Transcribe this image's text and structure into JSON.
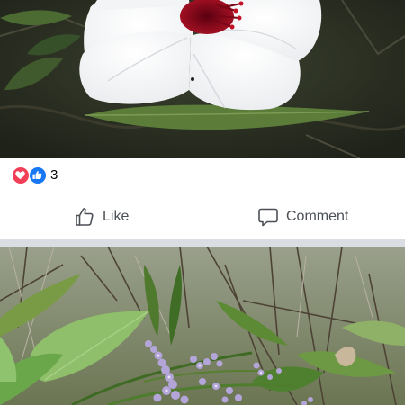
{
  "post": {
    "reactions": {
      "count": "3",
      "types": [
        "love-icon",
        "like-icon"
      ],
      "colors": {
        "love": "#f33e58",
        "like": "#1877f2"
      }
    },
    "actions": {
      "like_label": "Like",
      "comment_label": "Comment"
    },
    "photos": [
      {
        "subject": "white-hibiscus-flower-photo"
      },
      {
        "subject": "purple-wildflower-photo"
      }
    ]
  }
}
